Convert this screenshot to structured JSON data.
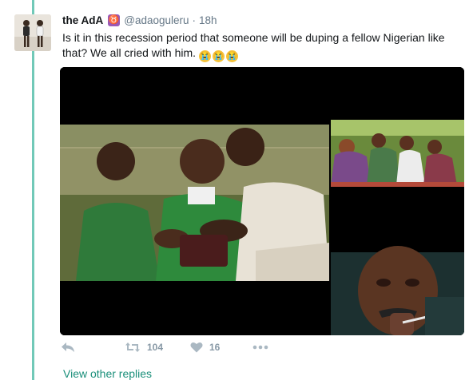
{
  "tweet": {
    "name": "the AdA",
    "zodiac_symbol": "♉",
    "handle": "@adaoguleru",
    "separator": "·",
    "time": "18h",
    "text": "Is it in this recession period that someone will be duping a fellow Nigerian like that? We all cried with him.",
    "emojis": [
      "😭",
      "😭",
      "😭"
    ]
  },
  "actions": {
    "reply_icon": "reply-icon",
    "retweet_icon": "retweet-icon",
    "retweet_count": "104",
    "like_icon": "heart-icon",
    "like_count": "16",
    "more_icon": "more-icon"
  },
  "thread": {
    "view_replies_label": "View other replies"
  },
  "colors": {
    "thread_line": "#71c9b8",
    "accent_link": "#1a8f7a",
    "muted_text": "#657786"
  }
}
